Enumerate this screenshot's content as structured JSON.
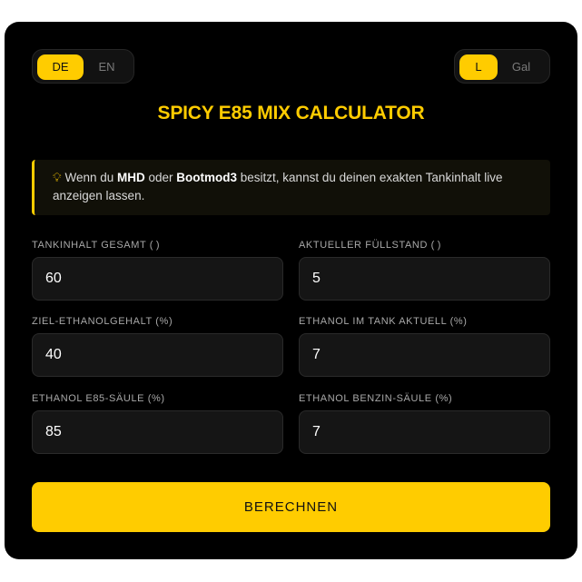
{
  "language_toggle": {
    "options": [
      "DE",
      "EN"
    ],
    "selected": "DE"
  },
  "unit_toggle": {
    "options": [
      "L",
      "Gal"
    ],
    "selected": "L"
  },
  "title": "SPICY E85 MIX CALCULATOR",
  "hint": {
    "icon": "lightbulb-icon",
    "before": "Wenn du ",
    "bold1": "MHD",
    "middle": " oder ",
    "bold2": "Bootmod3",
    "after": " besitzt, kannst du deinen exakten Tankinhalt live anzeigen lassen."
  },
  "fields": {
    "tank_total": {
      "label": "TANKINHALT GESAMT ( )",
      "value": "60"
    },
    "current_fill": {
      "label": "AKTUELLER FÜLLSTAND ( )",
      "value": "5"
    },
    "target_ethanol": {
      "label": "ZIEL-ETHANOLGEHALT (%)",
      "value": "40"
    },
    "current_ethanol": {
      "label": "ETHANOL IM TANK AKTUELL (%)",
      "value": "7"
    },
    "e85_pump": {
      "label": "ETHANOL E85-SÄULE (%)",
      "value": "85"
    },
    "petrol_pump": {
      "label": "ETHANOL BENZIN-SÄULE (%)",
      "value": "7"
    }
  },
  "calculate_button": "BERECHNEN",
  "colors": {
    "accent": "#ffcc00",
    "background": "#000000",
    "input_bg": "#151515"
  }
}
